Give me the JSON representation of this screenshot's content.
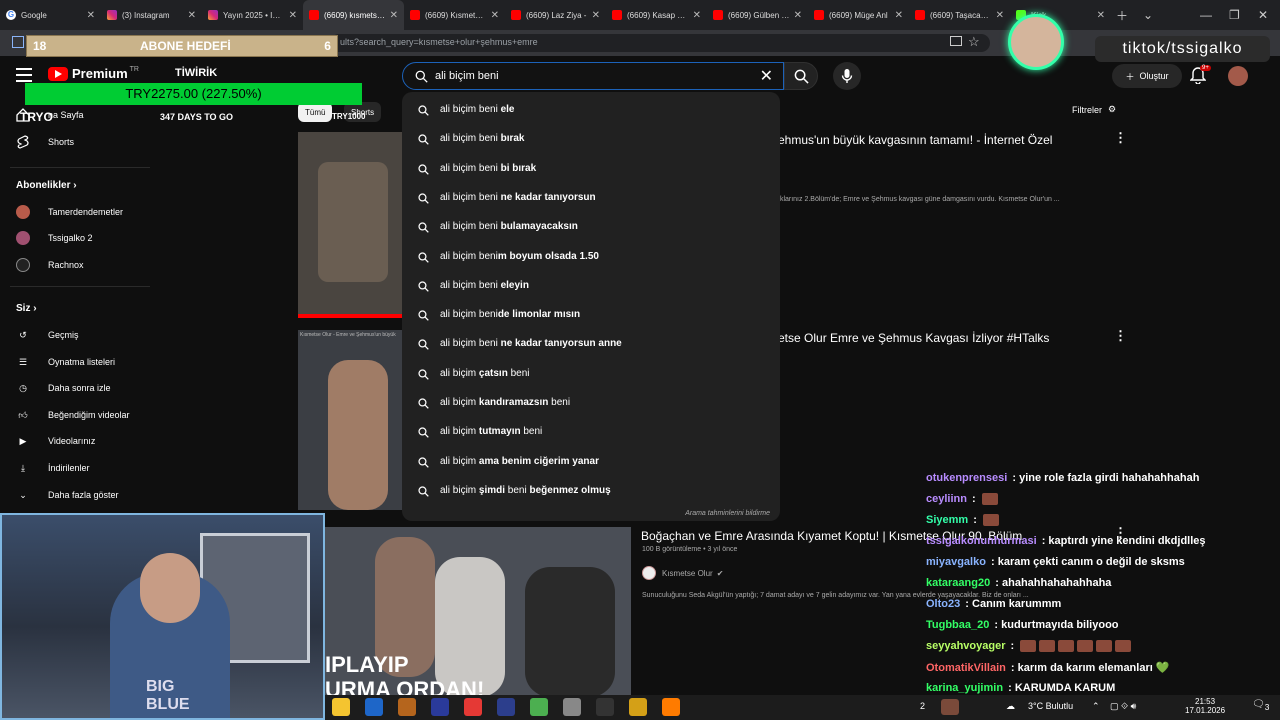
{
  "browser": {
    "tabs": [
      {
        "title": "Google",
        "icon": "google"
      },
      {
        "title": "(3) Instagram",
        "icon": "instagram"
      },
      {
        "title": "Yayın 2025 • Insta",
        "icon": "instagram"
      },
      {
        "title": "(6609) kısmetse o",
        "icon": "youtube",
        "active": true
      },
      {
        "title": "(6609) Kısmetse O",
        "icon": "youtube"
      },
      {
        "title": "(6609) Laz Ziya -",
        "icon": "youtube"
      },
      {
        "title": "(6609) Kasap Hal",
        "icon": "youtube"
      },
      {
        "title": "(6609) Gülben Erg",
        "icon": "youtube"
      },
      {
        "title": "(6609) Müge Anl",
        "icon": "youtube"
      },
      {
        "title": "(6609) Taşacak Bu",
        "icon": "youtube"
      },
      {
        "title": "Kick",
        "icon": "kick"
      }
    ],
    "url": "ults?search_query=kısmetse+olur+şehmus+emre"
  },
  "overlay": {
    "abone_count": "18",
    "abone_label": "ABONE HEDEFİ",
    "abone_goal": "6",
    "tiwirik_name": "TİWİRİK",
    "tiwirik_amount": "TRY2275.00 (227.50%)",
    "tiwirik_sub": "TRY1000",
    "days_to_go": "347 DAYS TO GO",
    "tryo": "TRYO",
    "tiktok": "tiktok/tssigalko"
  },
  "youtube": {
    "logo_text": "Premium",
    "logo_region": "TR",
    "search_value": "ali biçim beni",
    "create_label": "Oluştur",
    "notif_badge": "9+",
    "filters_label": "Filtreler",
    "chips": [
      "Tümü",
      "Shorts"
    ],
    "sidebar": {
      "home": "na Sayfa",
      "shorts": "Shorts",
      "subs_header": "Abonelikler",
      "subs": [
        "Tamerdendemetler",
        "Tssigalko 2",
        "Rachnox"
      ],
      "you_header": "Siz",
      "you_items": [
        "Geçmiş",
        "Oynatma listeleri",
        "Daha sonra izle",
        "Beğendiğim videolar",
        "Videolarınız",
        "İndirilenler",
        "Daha fazla göster"
      ]
    },
    "suggestions": [
      {
        "prefix": "ali biçim beni ",
        "bold": "ele"
      },
      {
        "prefix": "ali biçim beni ",
        "bold": "bırak"
      },
      {
        "prefix": "ali biçim beni ",
        "bold": "bi bırak"
      },
      {
        "prefix": "ali biçim beni ",
        "bold": "ne kadar tanıyorsun"
      },
      {
        "prefix": "ali biçim beni ",
        "bold": "bulamayacaksın"
      },
      {
        "prefix": "ali biçim beni",
        "bold": "m boyum olsada 1.50"
      },
      {
        "prefix": "ali biçim beni ",
        "bold": "eleyin"
      },
      {
        "prefix": "ali biçim beni",
        "bold": "de limonlar mısın"
      },
      {
        "prefix": "ali biçim beni ",
        "bold": "ne kadar tanıyorsun anne"
      },
      {
        "prefix": "ali biçim ",
        "bold": "çatsın",
        "suffix": " beni"
      },
      {
        "prefix": "ali biçim ",
        "bold": "kandıramazsın",
        "suffix": " beni"
      },
      {
        "prefix": "ali biçim ",
        "bold": "tutmayın",
        "suffix": " beni"
      },
      {
        "prefix": "ali biçim ",
        "bold": "ama benim ciğerim yanar"
      },
      {
        "prefix": "ali biçim ",
        "bold": "şimdi",
        "suffix": " beni ",
        "bold2": "beğenmez olmuş"
      }
    ],
    "suggestions_footer": "Arama tahminlerini bildirme",
    "results": [
      {
        "title": "ehmus'un büyük kavgasının tamamı! - İnternet Özel",
        "desc": "ıklarınız 2.Bölüm'de; Emre ve Şehmus kavgası güne damgasını vurdu. Kısmetse Olur'un ..."
      },
      {
        "title": "etse Olur Emre ve Şehmus Kavgası İzliyor #HTalks",
        "desc": "",
        "thumb_caption": "Kısmetse Olur - Emre ve Şehmus'un büyük"
      },
      {
        "title": "Boğaçhan ve Emre Arasında Kıyamet Koptu! | Kısmetse Olur 90. Bölüm",
        "meta": "100 B görüntüleme • 3 yıl önce",
        "channel": "Kısmetse Olur",
        "desc": "Sunuculuğunu Seda Akgül'ün yaptığı; 7 damat adayı ve 7 gelin adayımız var. Yan yana evlerde yaşayacaklar. Biz de onları ...",
        "thumb_text_1": "IPLAYIP",
        "thumb_text_2": "URMA ORDAN!"
      }
    ]
  },
  "chat": [
    {
      "user": "otukenprensesi",
      "color": "#b88cff",
      "msg": "yine role fazla girdi hahahahhahah"
    },
    {
      "user": "ceyliinn",
      "color": "#b88cff",
      "msg": "",
      "emote": true
    },
    {
      "user": "Siyemm",
      "color": "#33ffaa",
      "msg": "",
      "emote": true
    },
    {
      "user": "tssigalkonunhurmasi",
      "color": "#b88cff",
      "msg": "kaptırdı yine kendini dkdjdlleş"
    },
    {
      "user": "miyavgalko",
      "color": "#8ab4ff",
      "msg": "karam çekti canım o değil de sksms"
    },
    {
      "user": "kataraang20",
      "color": "#33ff66",
      "msg": "ahahahhahahahhaha"
    },
    {
      "user": "Olto23",
      "color": "#8ab4ff",
      "msg": "Canım karummm"
    },
    {
      "user": "Tugbbaa_20",
      "color": "#33ff66",
      "msg": "kudurtmayıda biliyooo"
    },
    {
      "user": "seyyahvoyager",
      "color": "#b8ff66",
      "msg": "",
      "emotes": 6
    },
    {
      "user": "OtomatikVillain",
      "color": "#ff6666",
      "msg": "karım da karım elemanları 💚"
    },
    {
      "user": "karina_yujimin",
      "color": "#33ff66",
      "msg": "KARUMDA KARUM"
    }
  ],
  "taskbar": {
    "weather": "3°C  Bulutlu",
    "time": "21:53",
    "date": "17.01.2026",
    "notif_count": "3",
    "count2": "2"
  }
}
